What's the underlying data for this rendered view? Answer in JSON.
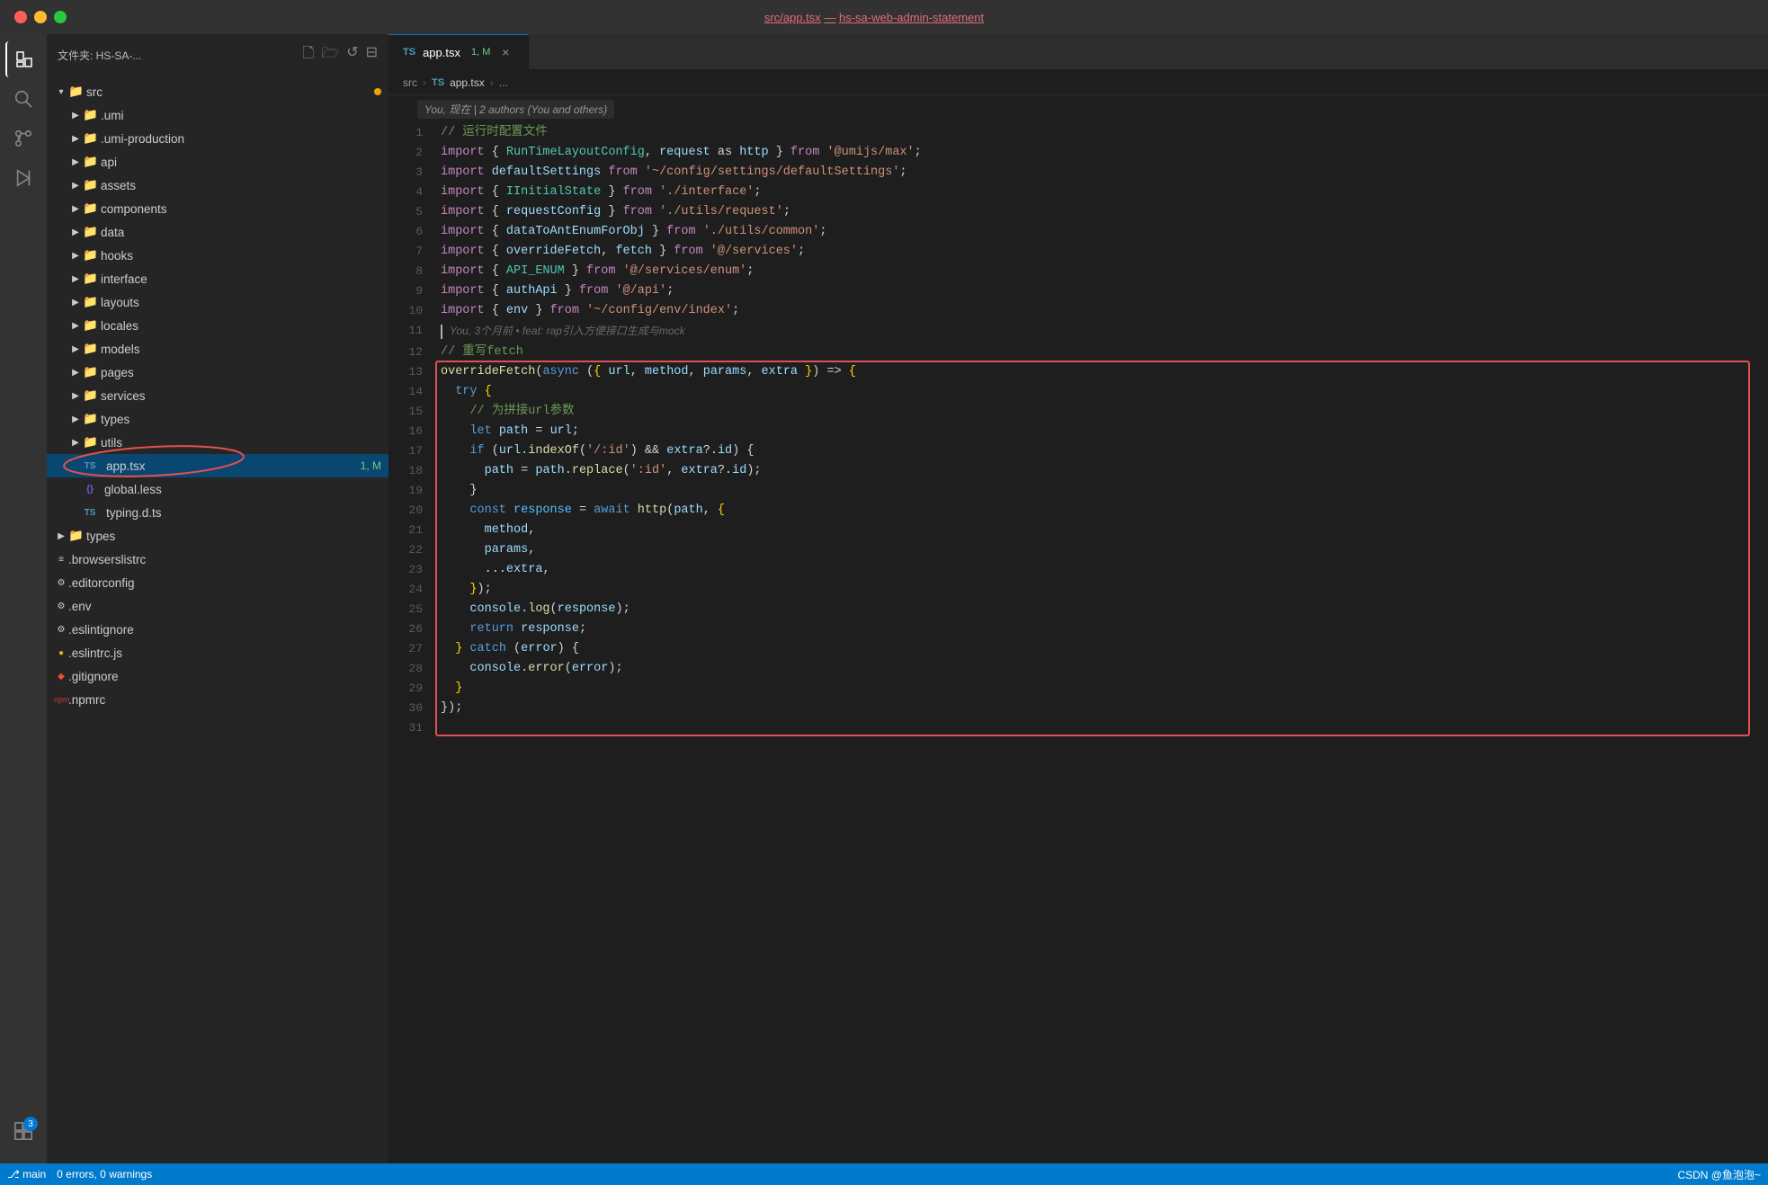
{
  "titleBar": {
    "title": "src/app.tsx",
    "separator": "—",
    "project": "hs-sa-web-admin-statement"
  },
  "sidebar": {
    "headerLabel": "文件夹: HS-SA-...",
    "icons": [
      "new-file",
      "new-folder",
      "refresh",
      "collapse-all"
    ],
    "tree": [
      {
        "id": "src",
        "label": "src",
        "type": "folder",
        "level": 0,
        "expanded": true,
        "badge": "yellow"
      },
      {
        "id": "umi",
        "label": ".umi",
        "type": "folder",
        "level": 1,
        "expanded": false
      },
      {
        "id": "umi-production",
        "label": ".umi-production",
        "type": "folder",
        "level": 1,
        "expanded": false
      },
      {
        "id": "api",
        "label": "api",
        "type": "folder",
        "level": 1,
        "expanded": false
      },
      {
        "id": "assets",
        "label": "assets",
        "type": "folder",
        "level": 1,
        "expanded": false
      },
      {
        "id": "components",
        "label": "components",
        "type": "folder",
        "level": 1,
        "expanded": false
      },
      {
        "id": "data",
        "label": "data",
        "type": "folder",
        "level": 1,
        "expanded": false
      },
      {
        "id": "hooks",
        "label": "hooks",
        "type": "folder",
        "level": 1,
        "expanded": false
      },
      {
        "id": "interface",
        "label": "interface",
        "type": "folder",
        "level": 1,
        "expanded": false
      },
      {
        "id": "layouts",
        "label": "layouts",
        "type": "folder",
        "level": 1,
        "expanded": false
      },
      {
        "id": "locales",
        "label": "locales",
        "type": "folder",
        "level": 1,
        "expanded": false
      },
      {
        "id": "models",
        "label": "models",
        "type": "folder",
        "level": 1,
        "expanded": false
      },
      {
        "id": "pages",
        "label": "pages",
        "type": "folder",
        "level": 1,
        "expanded": false
      },
      {
        "id": "services",
        "label": "services",
        "type": "folder",
        "level": 1,
        "expanded": false
      },
      {
        "id": "types",
        "label": "types",
        "type": "folder",
        "level": 1,
        "expanded": false
      },
      {
        "id": "utils",
        "label": "utils",
        "type": "folder",
        "level": 1,
        "expanded": false
      },
      {
        "id": "app.tsx",
        "label": "app.tsx",
        "type": "ts",
        "level": 1,
        "active": true,
        "mod": "1, M"
      },
      {
        "id": "global.less",
        "label": "global.less",
        "type": "less",
        "level": 1
      },
      {
        "id": "typing.d.ts",
        "label": "typing.d.ts",
        "type": "ts",
        "level": 1
      },
      {
        "id": "types-root",
        "label": "types",
        "type": "folder",
        "level": 0,
        "expanded": false
      },
      {
        "id": "browserslistrc",
        "label": ".browserslistrc",
        "type": "config",
        "level": 0
      },
      {
        "id": "editorconfig",
        "label": ".editorconfig",
        "type": "gear",
        "level": 0
      },
      {
        "id": "env",
        "label": ".env",
        "type": "gear",
        "level": 0
      },
      {
        "id": "eslintignore",
        "label": ".eslintignore",
        "type": "config",
        "level": 0
      },
      {
        "id": "eslintrc",
        "label": ".eslintrc.js",
        "type": "js",
        "level": 0
      },
      {
        "id": "gitignore",
        "label": ".gitignore",
        "type": "git",
        "level": 0
      },
      {
        "id": "npmrc",
        "label": ".npmrc",
        "type": "npm",
        "level": 0
      }
    ]
  },
  "editor": {
    "tab": {
      "icon": "TS",
      "label": "app.tsx",
      "badge": "1, M",
      "active": true
    },
    "breadcrumb": [
      "src",
      "TS app.tsx",
      "..."
    ],
    "gitBlame": "You, 现在 | 2 authors (You and others)",
    "lines": [
      {
        "num": 1,
        "content": "// 运行时配置文件",
        "type": "comment"
      },
      {
        "num": 2,
        "content": "import { RunTimeLayoutConfig, request as http } from '@umijs/max';",
        "type": "code"
      },
      {
        "num": 3,
        "content": "import defaultSettings from '~/config/settings/defaultSettings';",
        "type": "code"
      },
      {
        "num": 4,
        "content": "import { IInitialState } from './interface';",
        "type": "code"
      },
      {
        "num": 5,
        "content": "import { requestConfig } from './utils/request';",
        "type": "code"
      },
      {
        "num": 6,
        "content": "import { dataToAntEnumForObj } from './utils/common';",
        "type": "code"
      },
      {
        "num": 7,
        "content": "import { overrideFetch, fetch } from '@/services';",
        "type": "code"
      },
      {
        "num": 8,
        "content": "import { API_ENUM } from '@/services/enum';",
        "type": "code"
      },
      {
        "num": 9,
        "content": "import { authApi } from '@/api';",
        "type": "code"
      },
      {
        "num": 10,
        "content": "import { env } from '~/config/env/index';",
        "type": "code"
      },
      {
        "num": 11,
        "content": "",
        "type": "cursor",
        "blame": "You, 3个月前 • feat: rap引入方便接口生成与mock"
      },
      {
        "num": 12,
        "content": "// 重写fetch",
        "type": "comment"
      },
      {
        "num": 13,
        "content": "overrideFetch(async ({ url, method, params, extra }) => {",
        "type": "code"
      },
      {
        "num": 14,
        "content": "  try {",
        "type": "code"
      },
      {
        "num": 15,
        "content": "    // 为拼接url参数",
        "type": "comment-inline"
      },
      {
        "num": 16,
        "content": "    let path = url;",
        "type": "code"
      },
      {
        "num": 17,
        "content": "    if (url.indexOf('/:id') && extra?.id) {",
        "type": "code"
      },
      {
        "num": 18,
        "content": "      path = path.replace(':id', extra?.id);",
        "type": "code"
      },
      {
        "num": 19,
        "content": "    }",
        "type": "code"
      },
      {
        "num": 20,
        "content": "    const response = await http(path, {",
        "type": "code"
      },
      {
        "num": 21,
        "content": "      method,",
        "type": "code"
      },
      {
        "num": 22,
        "content": "      params,",
        "type": "code"
      },
      {
        "num": 23,
        "content": "      ...extra,",
        "type": "code"
      },
      {
        "num": 24,
        "content": "    });",
        "type": "code"
      },
      {
        "num": 25,
        "content": "    console.log(response);",
        "type": "code"
      },
      {
        "num": 26,
        "content": "    return response;",
        "type": "code"
      },
      {
        "num": 27,
        "content": "  } catch (error) {",
        "type": "code"
      },
      {
        "num": 28,
        "content": "    console.error(error);",
        "type": "code"
      },
      {
        "num": 29,
        "content": "  }",
        "type": "code"
      },
      {
        "num": 30,
        "content": "});",
        "type": "code"
      },
      {
        "num": 31,
        "content": "",
        "type": "empty"
      }
    ]
  },
  "statusBar": {
    "left": [
      "main",
      "0 errors, 0 warnings"
    ],
    "right": [
      "CSDN @鱼泡泡~"
    ]
  },
  "activityBar": {
    "icons": [
      {
        "id": "explorer",
        "symbol": "⊞",
        "active": true
      },
      {
        "id": "search",
        "symbol": "🔍"
      },
      {
        "id": "source-control",
        "symbol": "⑂"
      },
      {
        "id": "run",
        "symbol": "▷"
      },
      {
        "id": "extensions",
        "symbol": "⊟",
        "badge": "3"
      }
    ]
  }
}
